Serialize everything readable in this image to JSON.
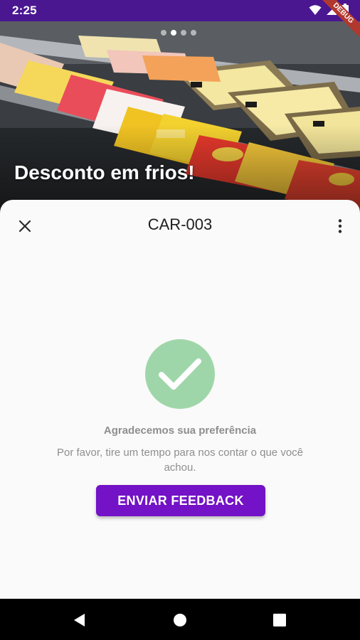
{
  "status_bar": {
    "time": "2:25",
    "icons": [
      "wifi-icon",
      "signal-icon",
      "battery-icon"
    ],
    "debug_label": "DEBUG",
    "color": "#4a1791"
  },
  "banner": {
    "title": "Desconto em frios!",
    "dots_total": 4,
    "active_dot": 1
  },
  "sheet": {
    "title": "CAR-003",
    "close_icon": "close-icon",
    "menu_icon": "more-vertical-icon",
    "success_icon": "check-icon",
    "success_color": "#9fd6a9",
    "thanks": "Agradecemos sua preferência",
    "prompt": "Por favor, tire um tempo para nos contar o que você achou.",
    "button_label": "ENVIAR FEEDBACK",
    "button_color": "#7312c6"
  },
  "nav_bar": {
    "icons": [
      "back-icon",
      "home-icon",
      "recents-icon"
    ]
  }
}
